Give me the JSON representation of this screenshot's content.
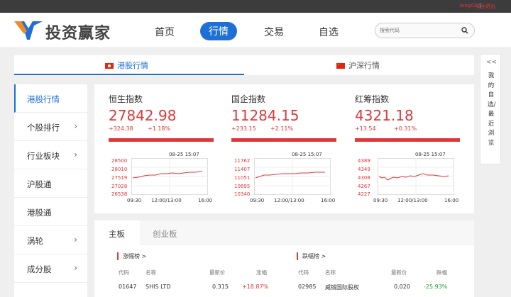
{
  "topbar": {
    "user": "bing02",
    "separator": "|",
    "logout": "安全退出"
  },
  "header": {
    "logo_text": "投资赢家",
    "nav": [
      "首页",
      "行情",
      "交易",
      "自选"
    ],
    "active_nav": "行情",
    "search_placeholder": "搜索代码"
  },
  "tabs": [
    {
      "label": "港股行情",
      "active": true
    },
    {
      "label": "沪深行情",
      "active": false
    }
  ],
  "sidebar": [
    {
      "label": "港股行情",
      "chevron": false,
      "active": true
    },
    {
      "label": "个股排行",
      "chevron": true
    },
    {
      "label": "行业板块",
      "chevron": true
    },
    {
      "label": "沪股通",
      "chevron": false
    },
    {
      "label": "港股通",
      "chevron": false
    },
    {
      "label": "涡轮",
      "chevron": true
    },
    {
      "label": "成分股",
      "chevron": true
    }
  ],
  "indices": [
    {
      "name": "恒生指数",
      "value": "27842.98",
      "change": "+324.38",
      "pct": "+1.18%",
      "timestamp": "08-25 15:07",
      "y_ticks": [
        "28500",
        "28010",
        "27519",
        "27028",
        "26538"
      ],
      "x_ticks": [
        "09:30",
        "12:00/13:00",
        "16:00"
      ]
    },
    {
      "name": "国企指数",
      "value": "11284.15",
      "change": "+233.15",
      "pct": "+2.11%",
      "timestamp": "08-25 15:07",
      "y_ticks": [
        "11762",
        "11407",
        "11051",
        "10695",
        "10340"
      ],
      "x_ticks": [
        "09:30",
        "12:00/13:00",
        "16:00"
      ]
    },
    {
      "name": "红筹指数",
      "value": "4321.18",
      "change": "+13.54",
      "pct": "+0.31%",
      "timestamp": "08-25 15:07",
      "y_ticks": [
        "4389",
        "4349",
        "4308",
        "4267",
        "4227"
      ],
      "x_ticks": [
        "09:30",
        "12:00/13:00",
        "16:00"
      ]
    }
  ],
  "board_tabs": [
    "主板",
    "创业板"
  ],
  "gainers": {
    "title": "涨幅榜 >",
    "headers": [
      "代码",
      "名称",
      "最新价",
      "涨幅"
    ],
    "rows": [
      {
        "code": "01647",
        "name": "SHIS LTD",
        "price": "0.315",
        "pct": "+18.87%"
      }
    ]
  },
  "losers": {
    "title": "跌幅榜 >",
    "headers": [
      "代码",
      "名称",
      "最新价",
      "跌幅"
    ],
    "rows": [
      {
        "code": "02985",
        "name": "威铖国际股权",
        "price": "0.020",
        "pct": "-25.93%"
      }
    ]
  },
  "right_panel": {
    "arrow": "<<",
    "text": "我的自选/最近浏览"
  },
  "colors": {
    "accent": "#1e6fd6",
    "up": "#e0373b",
    "down": "#1a9a2a"
  }
}
